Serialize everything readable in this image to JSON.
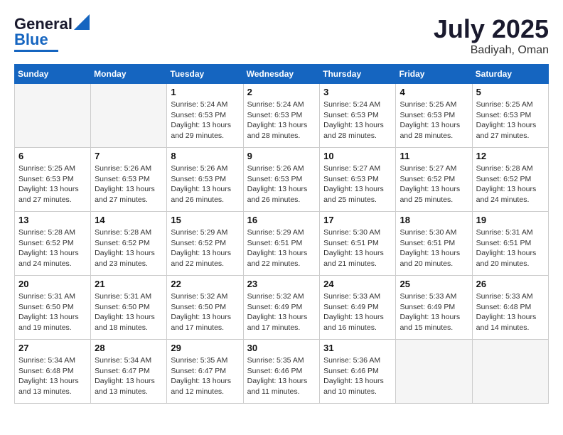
{
  "header": {
    "logo_general": "General",
    "logo_blue": "Blue",
    "month": "July 2025",
    "location": "Badiyah, Oman"
  },
  "weekdays": [
    "Sunday",
    "Monday",
    "Tuesday",
    "Wednesday",
    "Thursday",
    "Friday",
    "Saturday"
  ],
  "weeks": [
    [
      {
        "day": "",
        "info": ""
      },
      {
        "day": "",
        "info": ""
      },
      {
        "day": "1",
        "info": "Sunrise: 5:24 AM\nSunset: 6:53 PM\nDaylight: 13 hours and 29 minutes."
      },
      {
        "day": "2",
        "info": "Sunrise: 5:24 AM\nSunset: 6:53 PM\nDaylight: 13 hours and 28 minutes."
      },
      {
        "day": "3",
        "info": "Sunrise: 5:24 AM\nSunset: 6:53 PM\nDaylight: 13 hours and 28 minutes."
      },
      {
        "day": "4",
        "info": "Sunrise: 5:25 AM\nSunset: 6:53 PM\nDaylight: 13 hours and 28 minutes."
      },
      {
        "day": "5",
        "info": "Sunrise: 5:25 AM\nSunset: 6:53 PM\nDaylight: 13 hours and 27 minutes."
      }
    ],
    [
      {
        "day": "6",
        "info": "Sunrise: 5:25 AM\nSunset: 6:53 PM\nDaylight: 13 hours and 27 minutes."
      },
      {
        "day": "7",
        "info": "Sunrise: 5:26 AM\nSunset: 6:53 PM\nDaylight: 13 hours and 27 minutes."
      },
      {
        "day": "8",
        "info": "Sunrise: 5:26 AM\nSunset: 6:53 PM\nDaylight: 13 hours and 26 minutes."
      },
      {
        "day": "9",
        "info": "Sunrise: 5:26 AM\nSunset: 6:53 PM\nDaylight: 13 hours and 26 minutes."
      },
      {
        "day": "10",
        "info": "Sunrise: 5:27 AM\nSunset: 6:53 PM\nDaylight: 13 hours and 25 minutes."
      },
      {
        "day": "11",
        "info": "Sunrise: 5:27 AM\nSunset: 6:52 PM\nDaylight: 13 hours and 25 minutes."
      },
      {
        "day": "12",
        "info": "Sunrise: 5:28 AM\nSunset: 6:52 PM\nDaylight: 13 hours and 24 minutes."
      }
    ],
    [
      {
        "day": "13",
        "info": "Sunrise: 5:28 AM\nSunset: 6:52 PM\nDaylight: 13 hours and 24 minutes."
      },
      {
        "day": "14",
        "info": "Sunrise: 5:28 AM\nSunset: 6:52 PM\nDaylight: 13 hours and 23 minutes."
      },
      {
        "day": "15",
        "info": "Sunrise: 5:29 AM\nSunset: 6:52 PM\nDaylight: 13 hours and 22 minutes."
      },
      {
        "day": "16",
        "info": "Sunrise: 5:29 AM\nSunset: 6:51 PM\nDaylight: 13 hours and 22 minutes."
      },
      {
        "day": "17",
        "info": "Sunrise: 5:30 AM\nSunset: 6:51 PM\nDaylight: 13 hours and 21 minutes."
      },
      {
        "day": "18",
        "info": "Sunrise: 5:30 AM\nSunset: 6:51 PM\nDaylight: 13 hours and 20 minutes."
      },
      {
        "day": "19",
        "info": "Sunrise: 5:31 AM\nSunset: 6:51 PM\nDaylight: 13 hours and 20 minutes."
      }
    ],
    [
      {
        "day": "20",
        "info": "Sunrise: 5:31 AM\nSunset: 6:50 PM\nDaylight: 13 hours and 19 minutes."
      },
      {
        "day": "21",
        "info": "Sunrise: 5:31 AM\nSunset: 6:50 PM\nDaylight: 13 hours and 18 minutes."
      },
      {
        "day": "22",
        "info": "Sunrise: 5:32 AM\nSunset: 6:50 PM\nDaylight: 13 hours and 17 minutes."
      },
      {
        "day": "23",
        "info": "Sunrise: 5:32 AM\nSunset: 6:49 PM\nDaylight: 13 hours and 17 minutes."
      },
      {
        "day": "24",
        "info": "Sunrise: 5:33 AM\nSunset: 6:49 PM\nDaylight: 13 hours and 16 minutes."
      },
      {
        "day": "25",
        "info": "Sunrise: 5:33 AM\nSunset: 6:49 PM\nDaylight: 13 hours and 15 minutes."
      },
      {
        "day": "26",
        "info": "Sunrise: 5:33 AM\nSunset: 6:48 PM\nDaylight: 13 hours and 14 minutes."
      }
    ],
    [
      {
        "day": "27",
        "info": "Sunrise: 5:34 AM\nSunset: 6:48 PM\nDaylight: 13 hours and 13 minutes."
      },
      {
        "day": "28",
        "info": "Sunrise: 5:34 AM\nSunset: 6:47 PM\nDaylight: 13 hours and 13 minutes."
      },
      {
        "day": "29",
        "info": "Sunrise: 5:35 AM\nSunset: 6:47 PM\nDaylight: 13 hours and 12 minutes."
      },
      {
        "day": "30",
        "info": "Sunrise: 5:35 AM\nSunset: 6:46 PM\nDaylight: 13 hours and 11 minutes."
      },
      {
        "day": "31",
        "info": "Sunrise: 5:36 AM\nSunset: 6:46 PM\nDaylight: 13 hours and 10 minutes."
      },
      {
        "day": "",
        "info": ""
      },
      {
        "day": "",
        "info": ""
      }
    ]
  ]
}
